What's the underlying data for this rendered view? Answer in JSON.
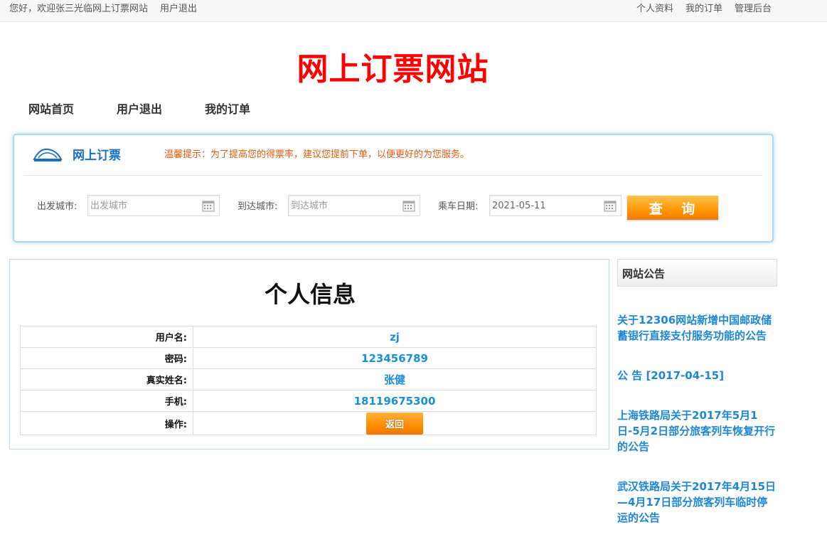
{
  "topbar": {
    "welcome": "您好，欢迎张三光临网上订票网站",
    "logout": "用户退出",
    "links": [
      "个人资料",
      "我的订单",
      "管理后台"
    ]
  },
  "site_title": "网上订票网站",
  "nav": [
    "网站首页",
    "用户退出",
    "我的订单"
  ],
  "booking": {
    "title": "网上订票",
    "tip": "温馨提示：为了提高您的得票率，建议您提前下单，以便更好的为您服务。",
    "from_label": "出发城市:",
    "from_placeholder": "出发城市",
    "to_label": "到达城市:",
    "to_placeholder": "到达城市",
    "date_label": "乘车日期:",
    "date_value": "2021-05-11",
    "query_button": "查 询",
    "colors": {
      "border": "#a8d8f5",
      "title": "#1a6fc3",
      "tip": "#e05a0c",
      "button": "#ff9a0a"
    }
  },
  "profile": {
    "title": "个人信息",
    "rows": [
      {
        "label": "用户名:",
        "value": "zj"
      },
      {
        "label": "密码:",
        "value": "123456789"
      },
      {
        "label": "真实姓名:",
        "value": "张健"
      },
      {
        "label": "手机:",
        "value": "18119675300"
      }
    ],
    "action_label": "操作:",
    "back_button": "返回",
    "value_color": "#1a8fd8"
  },
  "notices": {
    "header": "网站公告",
    "items": [
      "关于12306网站新增中国邮政储蓄银行直接支付服务功能的公告",
      "公 告 [2017-04-15]",
      "上海铁路局关于2017年5月1日-5月2日部分旅客列车恢复开行的公告",
      "武汉铁路局关于2017年4月15日—4月17日部分旅客列车临时停运的公告"
    ],
    "link_color": "#1e86d4"
  }
}
